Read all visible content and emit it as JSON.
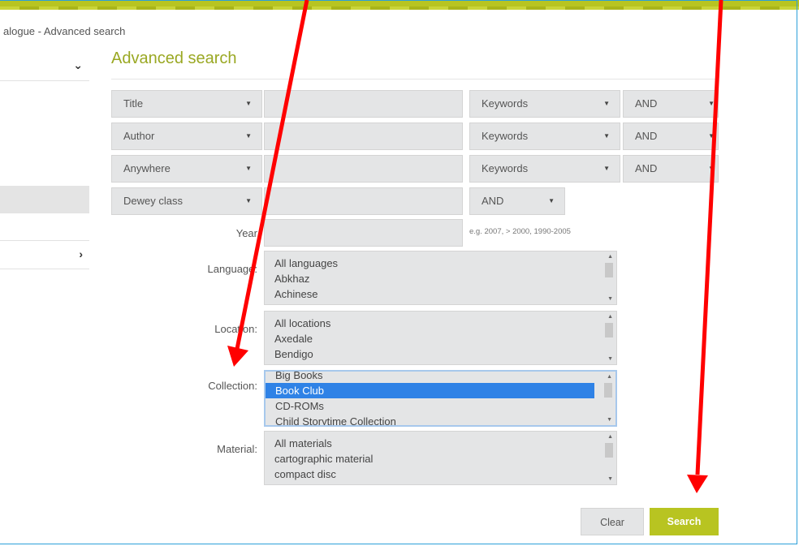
{
  "breadcrumb": "alogue - Advanced search",
  "page_title": "Advanced search",
  "colors": {
    "accent": "#b8c421",
    "title": "#9aa823",
    "frame": "#2b9fd9",
    "annotation": "#ff0000",
    "selection": "#2f82e6"
  },
  "rows": [
    {
      "field": "Title",
      "match": "Keywords",
      "op": "AND"
    },
    {
      "field": "Author",
      "match": "Keywords",
      "op": "AND"
    },
    {
      "field": "Anywhere",
      "match": "Keywords",
      "op": "AND"
    }
  ],
  "dewey": {
    "field": "Dewey class",
    "op": "AND"
  },
  "year": {
    "label": "Year",
    "hint": "e.g. 2007, > 2000, 1990-2005"
  },
  "language": {
    "label": "Language:",
    "items": [
      "All languages",
      "Abkhaz",
      "Achinese"
    ]
  },
  "location": {
    "label": "Location:",
    "items": [
      "All locations",
      "Axedale",
      "Bendigo"
    ]
  },
  "collection": {
    "label": "Collection:",
    "items": [
      "Big Books",
      "Book Club",
      "CD-ROMs",
      "Child Storytime Collection"
    ],
    "selected": "Book Club"
  },
  "material": {
    "label": "Material:",
    "items": [
      "All materials",
      "cartographic material",
      "compact disc"
    ]
  },
  "buttons": {
    "clear": "Clear",
    "search": "Search"
  },
  "icons": {
    "dropdown": "triangle-down",
    "expand": "chevron-down",
    "forward": "chevron-right"
  }
}
